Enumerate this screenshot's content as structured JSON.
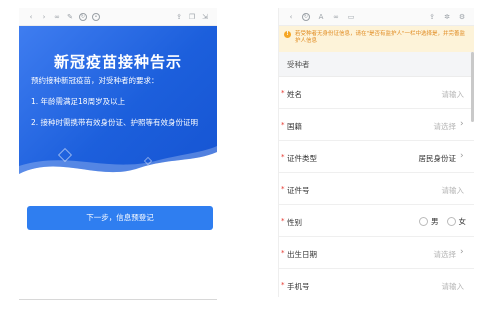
{
  "colors": {
    "primary_blue": "#2f7ef0",
    "banner_blue": "#1c5fdc",
    "required_red": "#e5332a",
    "notice_orange": "#e08a1f",
    "notice_bg": "#fdf3d9"
  },
  "left": {
    "banner": {
      "title": "新冠疫苗接种告示",
      "intro": "预约接种新冠疫苗，对受种者的要求：",
      "item1": "1. 年龄需满足18周岁及以上",
      "item2": "2. 接种时需携带有效身份证、护照等有效身份证明"
    },
    "next_button": "下一步，信息预登记"
  },
  "right": {
    "notice": "若受种者无身份证信息，请在\"是否有监护人\"一栏中选择是，并完善监护人信息",
    "section_title": "受种者",
    "fields": {
      "name": {
        "label": "姓名",
        "placeholder": "请输入"
      },
      "nationality": {
        "label": "国籍",
        "placeholder": "请选择"
      },
      "id_type": {
        "label": "证件类型",
        "value": "居民身份证"
      },
      "id_number": {
        "label": "证件号",
        "placeholder": "请输入"
      },
      "gender": {
        "label": "性别",
        "option_male": "男",
        "option_female": "女"
      },
      "birth_date": {
        "label": "出生日期",
        "placeholder": "请选择"
      },
      "phone": {
        "label": "手机号",
        "placeholder": "请输入"
      }
    }
  }
}
